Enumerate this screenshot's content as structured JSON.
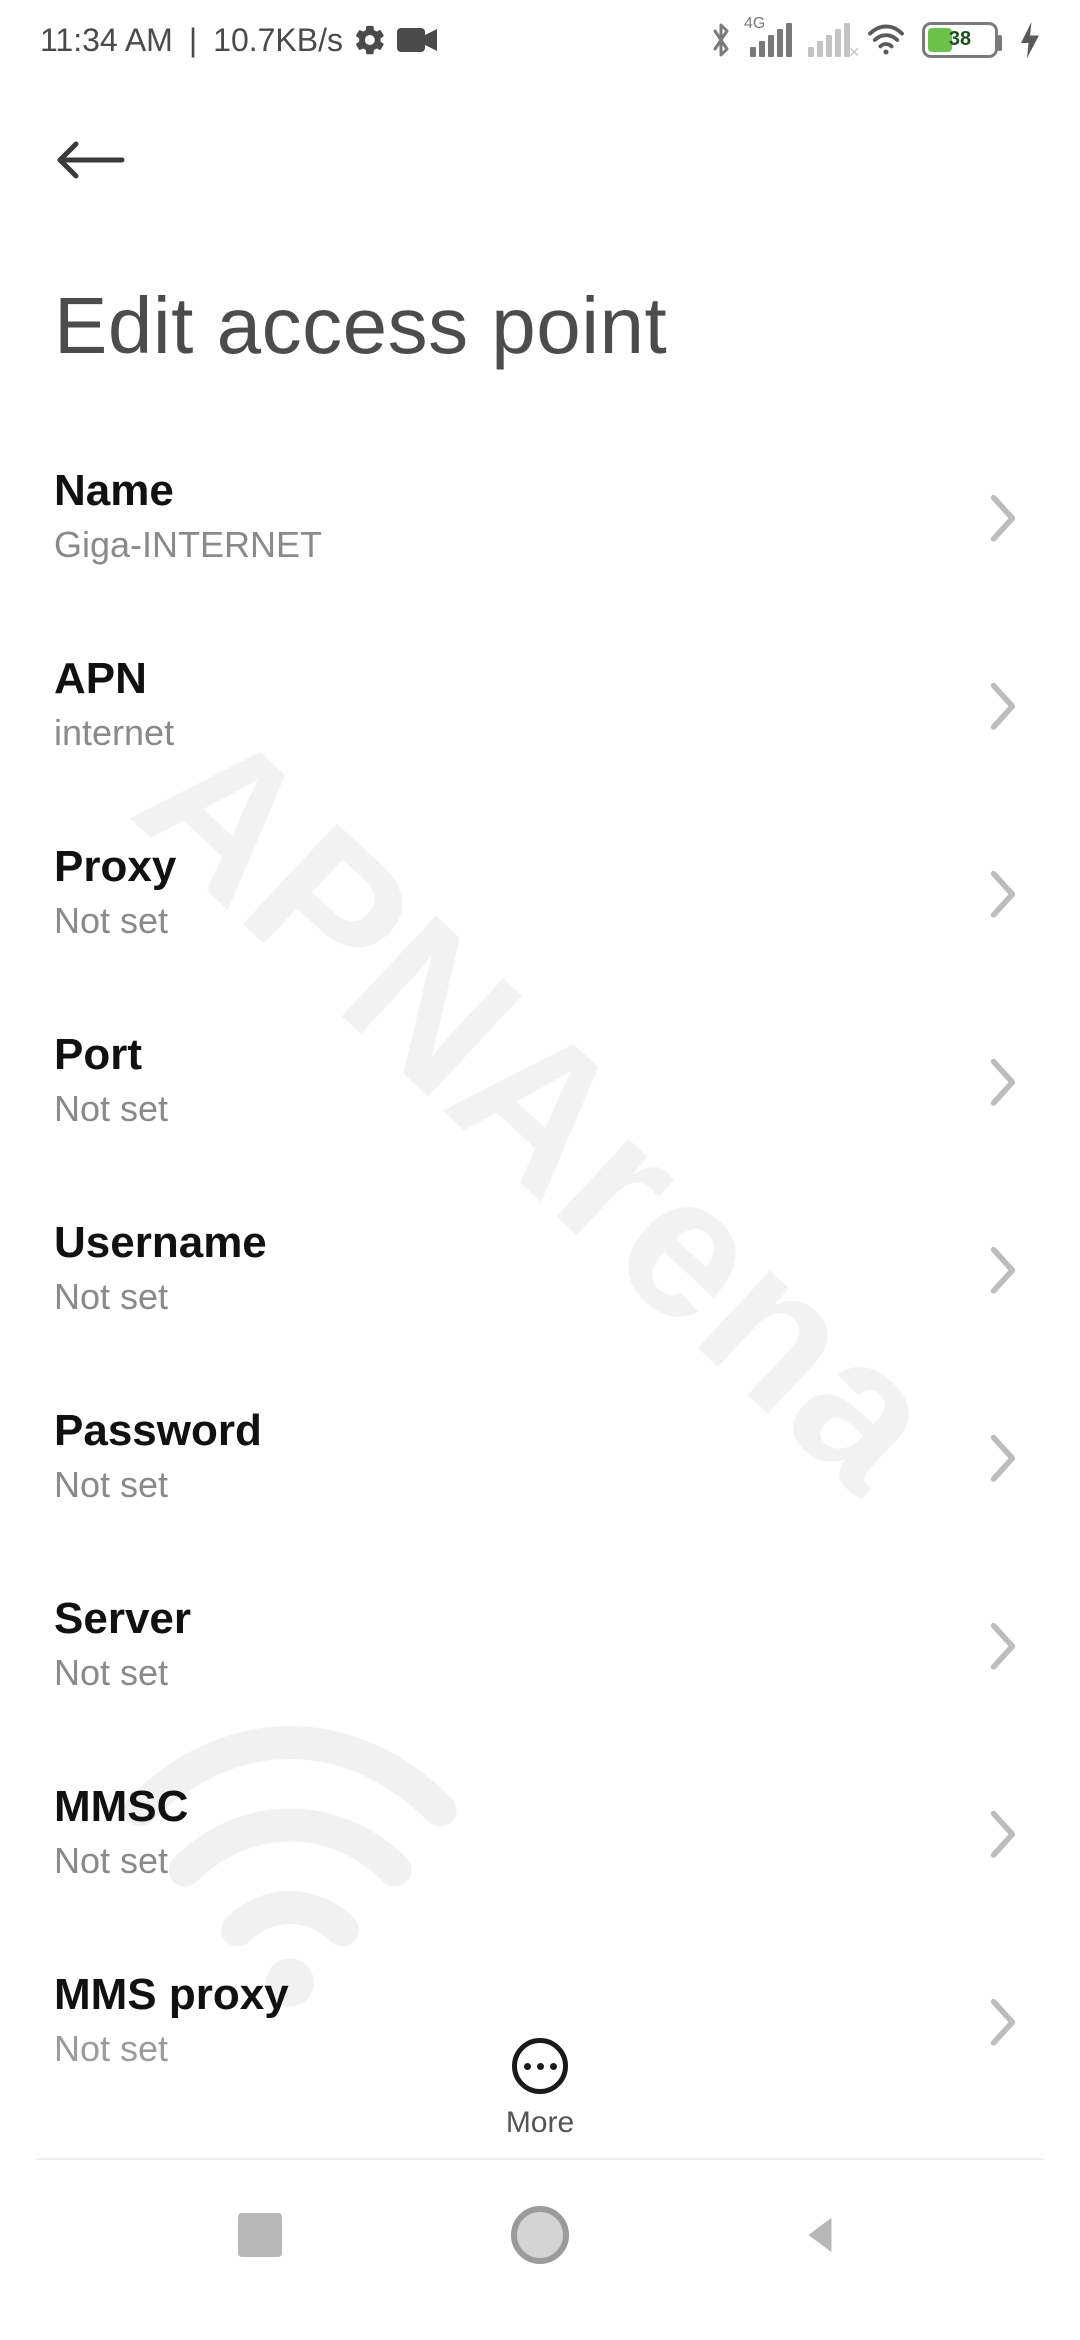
{
  "status_bar": {
    "time": "11:34 AM",
    "net_speed": "10.7KB/s",
    "net_label_4g": "4G",
    "battery_percent": "38"
  },
  "header": {
    "title": "Edit access point"
  },
  "settings": [
    {
      "label": "Name",
      "value": "Giga-INTERNET"
    },
    {
      "label": "APN",
      "value": "internet"
    },
    {
      "label": "Proxy",
      "value": "Not set"
    },
    {
      "label": "Port",
      "value": "Not set"
    },
    {
      "label": "Username",
      "value": "Not set"
    },
    {
      "label": "Password",
      "value": "Not set"
    },
    {
      "label": "Server",
      "value": "Not set"
    },
    {
      "label": "MMSC",
      "value": "Not set"
    },
    {
      "label": "MMS proxy",
      "value": "Not set"
    }
  ],
  "footer": {
    "more_label": "More"
  },
  "watermark": {
    "text": "APNArena"
  }
}
